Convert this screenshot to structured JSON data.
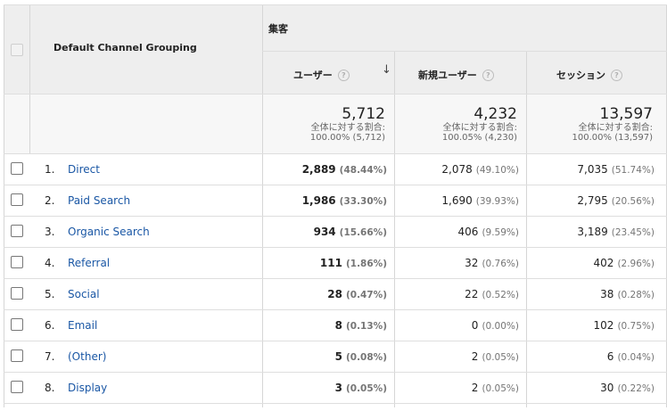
{
  "header": {
    "dimension_title": "Default Channel Grouping",
    "group_title": "集客",
    "metrics": [
      {
        "label": "ユーザー",
        "help": "?",
        "sort_icon": "arrow-down-icon"
      },
      {
        "label": "新規ユーザー",
        "help": "?"
      },
      {
        "label": "セッション",
        "help": "?"
      }
    ]
  },
  "totals": [
    {
      "value": "5,712",
      "share_label": "全体に対する割合:",
      "share": "100.00% (5,712)"
    },
    {
      "value": "4,232",
      "share_label": "全体に対する割合:",
      "share": "100.05% (4,230)"
    },
    {
      "value": "13,597",
      "share_label": "全体に対する割合:",
      "share": "100.00% (13,597)"
    }
  ],
  "rows": [
    {
      "index": "1.",
      "channel": "Direct",
      "users": "2,889",
      "users_pct": "(48.44%)",
      "new_users": "2,078",
      "new_users_pct": "(49.10%)",
      "sessions": "7,035",
      "sessions_pct": "(51.74%)"
    },
    {
      "index": "2.",
      "channel": "Paid Search",
      "users": "1,986",
      "users_pct": "(33.30%)",
      "new_users": "1,690",
      "new_users_pct": "(39.93%)",
      "sessions": "2,795",
      "sessions_pct": "(20.56%)"
    },
    {
      "index": "3.",
      "channel": "Organic Search",
      "users": "934",
      "users_pct": "(15.66%)",
      "new_users": "406",
      "new_users_pct": "(9.59%)",
      "sessions": "3,189",
      "sessions_pct": "(23.45%)"
    },
    {
      "index": "4.",
      "channel": "Referral",
      "users": "111",
      "users_pct": "(1.86%)",
      "new_users": "32",
      "new_users_pct": "(0.76%)",
      "sessions": "402",
      "sessions_pct": "(2.96%)"
    },
    {
      "index": "5.",
      "channel": "Social",
      "users": "28",
      "users_pct": "(0.47%)",
      "new_users": "22",
      "new_users_pct": "(0.52%)",
      "sessions": "38",
      "sessions_pct": "(0.28%)"
    },
    {
      "index": "6.",
      "channel": "Email",
      "users": "8",
      "users_pct": "(0.13%)",
      "new_users": "0",
      "new_users_pct": "(0.00%)",
      "sessions": "102",
      "sessions_pct": "(0.75%)"
    },
    {
      "index": "7.",
      "channel": "(Other)",
      "users": "5",
      "users_pct": "(0.08%)",
      "new_users": "2",
      "new_users_pct": "(0.05%)",
      "sessions": "6",
      "sessions_pct": "(0.04%)"
    },
    {
      "index": "8.",
      "channel": "Display",
      "users": "3",
      "users_pct": "(0.05%)",
      "new_users": "2",
      "new_users_pct": "(0.05%)",
      "sessions": "30",
      "sessions_pct": "(0.22%)"
    }
  ],
  "colors": {
    "link": "#1a57a5",
    "header_bg": "#eeeeee",
    "totals_bg": "#f7f7f7",
    "grid": "#dedede"
  }
}
